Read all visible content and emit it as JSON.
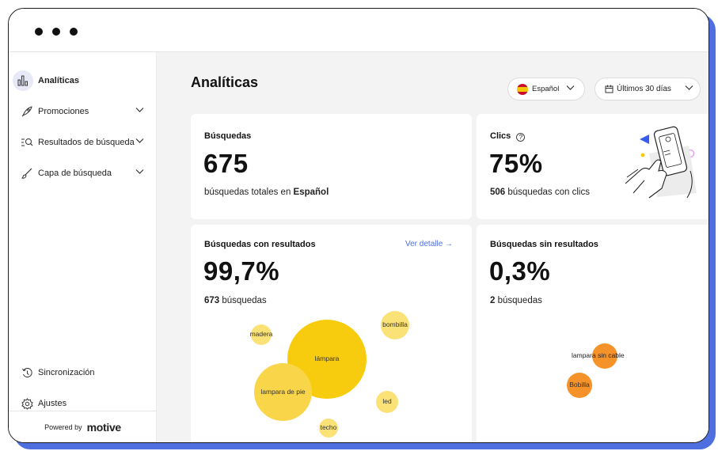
{
  "window": {
    "dots": [
      "close",
      "minimize",
      "maximize"
    ]
  },
  "sidebar": {
    "items": [
      {
        "label": "Analíticas",
        "icon": "bar-chart-icon",
        "active": true
      },
      {
        "label": "Promociones",
        "icon": "rocket-icon"
      },
      {
        "label": "Resultados de búsqueda",
        "icon": "search-list-icon"
      },
      {
        "label": "Capa de búsqueda",
        "icon": "brush-icon"
      }
    ],
    "bottom_items": [
      {
        "label": "Sincronización",
        "icon": "sync-history-icon"
      },
      {
        "label": "Ajustes",
        "icon": "gear-icon"
      }
    ],
    "powered_by": "Powered by",
    "brand": "motive"
  },
  "header": {
    "title": "Analíticas",
    "language": "Español",
    "date_range": "Últimos 30 días"
  },
  "cards": {
    "searches": {
      "title": "Búsquedas",
      "value": "675",
      "sub_prefix": "búsquedas totales en ",
      "sub_bold": "Español"
    },
    "clicks": {
      "title": "Clics",
      "value": "75%",
      "sub_bold": "506",
      "sub_suffix": " búsquedas con clics"
    },
    "with_results": {
      "title": "Búsquedas con resultados",
      "value": "99,7%",
      "sub_bold": "673",
      "sub_suffix": " búsquedas",
      "link": "Ver detalle →",
      "terms": [
        "madera",
        "lámpara",
        "bombilla",
        "lampara de pie",
        "led",
        "techo"
      ]
    },
    "without_results": {
      "title": "Búsquedas sin resultados",
      "value": "0,3%",
      "sub_bold": "2",
      "sub_suffix": " búsquedas",
      "terms": [
        "lampara sin cable",
        "Bobilla"
      ]
    }
  },
  "colors": {
    "accent": "#4f6fe0",
    "yellow": "#f8cc0e",
    "light_yellow": "#fbe277",
    "orange": "#f5922a"
  }
}
